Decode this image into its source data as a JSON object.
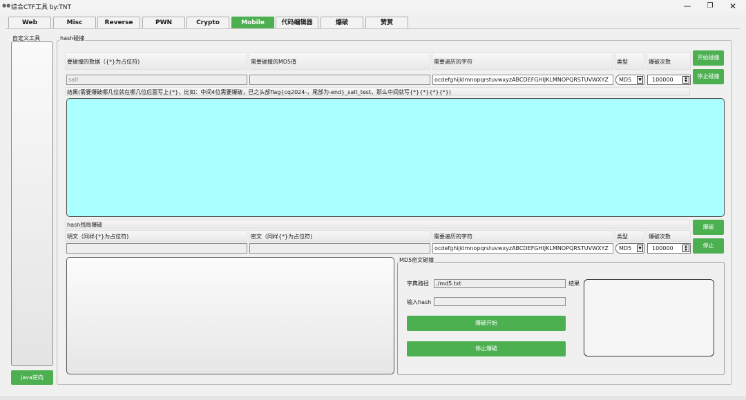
{
  "window": {
    "title": "综合CTF工具   by:TNT",
    "icon": "app-icon",
    "controls": {
      "minimize": "—",
      "maximize": "❐",
      "close": "✕"
    }
  },
  "tabs": [
    {
      "label": "Web"
    },
    {
      "label": "Misc"
    },
    {
      "label": "Reverse"
    },
    {
      "label": "PWN"
    },
    {
      "label": "Crypto"
    },
    {
      "label": "Mobile",
      "active": true
    },
    {
      "label": "代码编辑器"
    },
    {
      "label": "爆破"
    },
    {
      "label": "赞赏"
    }
  ],
  "sidebar": {
    "title": "自定义工具",
    "java_button": "java逆向"
  },
  "hash_collision": {
    "group_title": "hash碰撞",
    "col_data": "要碰撞的数据（{*}为占位符)",
    "col_md5": "需要碰撞的MD5值",
    "col_charset": "需要遍历的字符",
    "col_type": "类型",
    "col_count": "爆破次数",
    "data_placeholder": "salt",
    "md5_value": "",
    "charset_value": "ocdefghijklmnopqrstuvwxyzABCDEFGHIJKLMNOPQRSTUVWXYZ",
    "type_value": "MD5",
    "count_value": "100000",
    "start_button": "开始碰撞",
    "stop_button": "停止碰撞",
    "result_hint": "结果(需要爆破哪几位就在哪几位后面写上{*}，比如：中间4位需要爆破，已之头部flag{cq2024-，尾部为-end}_salt_test，那么中间就写{*}{*}{*}{*})",
    "result_text": ""
  },
  "hash_mask": {
    "title": "hash残局爆破",
    "col_plain": "明文（同样{*}为占位符)",
    "col_cipher": "密文（同样{*}为占位符)",
    "col_charset": "需要遍历的字符",
    "col_type": "类型",
    "col_count": "爆破次数",
    "plain_value": "",
    "cipher_value": "",
    "charset_value": "ocdefghijklmnopqrstuvwxyzABCDEFGHIJKLMNOPQRSTUVWXYZ",
    "type_value": "MD5",
    "count_value": "100000",
    "crack_button": "爆破",
    "stop_button": "停止",
    "output_text": ""
  },
  "md5_collision": {
    "title": "MD5密文碰撞",
    "dict_label": "字典路径",
    "dict_value": "./md5.txt",
    "hash_label": "输入hash",
    "hash_value": "",
    "result_label": "结果",
    "start_button": "爆破开始",
    "stop_button": "停止爆破",
    "result_text": ""
  },
  "colors": {
    "accent": "#4caf50",
    "result_bg": "#aaffff"
  }
}
